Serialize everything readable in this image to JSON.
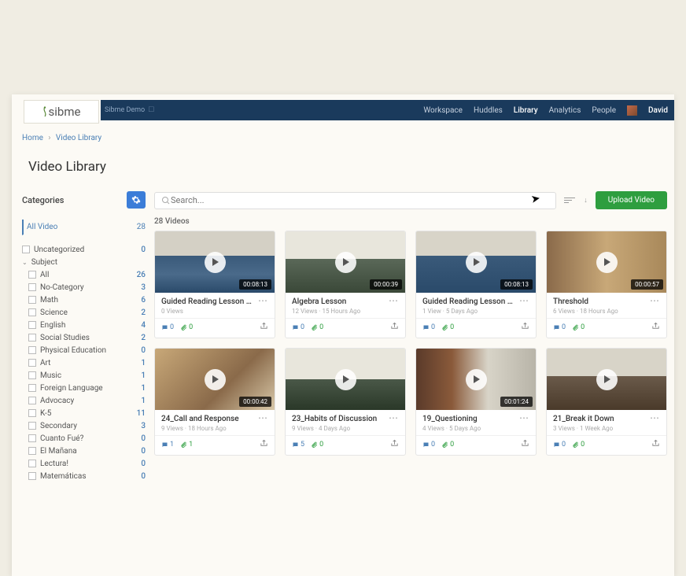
{
  "brand": "sibme",
  "subaccount": "Sibme Demo",
  "nav": {
    "items": [
      "Workspace",
      "Huddles",
      "Library",
      "Analytics",
      "People"
    ],
    "active": 2,
    "user": "David"
  },
  "breadcrumb": {
    "home": "Home",
    "page": "Video Library"
  },
  "page_title": "Video Library",
  "sidebar": {
    "title": "Categories",
    "all_video_label": "All Video",
    "all_video_count": "28",
    "uncategorized": {
      "label": "Uncategorized",
      "count": "0"
    },
    "subject_label": "Subject",
    "subjects": [
      {
        "label": "All",
        "count": "26"
      },
      {
        "label": "No-Category",
        "count": "3"
      },
      {
        "label": "Math",
        "count": "6"
      },
      {
        "label": "Science",
        "count": "2"
      },
      {
        "label": "English",
        "count": "4"
      },
      {
        "label": "Social Studies",
        "count": "2"
      },
      {
        "label": "Physical Education",
        "count": "0"
      },
      {
        "label": "Art",
        "count": "1"
      },
      {
        "label": "Music",
        "count": "1"
      },
      {
        "label": "Foreign Language",
        "count": "1"
      },
      {
        "label": "Advocacy",
        "count": "1"
      },
      {
        "label": "K-5",
        "count": "11"
      },
      {
        "label": "Secondary",
        "count": "3"
      },
      {
        "label": "Cuanto Fué?",
        "count": "0"
      },
      {
        "label": "El Mañana",
        "count": "0"
      },
      {
        "label": "Lectura!",
        "count": "0"
      },
      {
        "label": "Matemáticas",
        "count": "0"
      }
    ]
  },
  "search": {
    "placeholder": "Search..."
  },
  "upload_label": "Upload Video",
  "video_count": "28 Videos",
  "videos": [
    {
      "title": "Guided Reading Lesson 1...",
      "meta": "0 Views",
      "duration": "00:08:13",
      "c": "0",
      "a": "0",
      "thumb": "th1"
    },
    {
      "title": "Algebra Lesson",
      "meta": "12 Views · 15 Hours Ago",
      "duration": "00:00:39",
      "c": "0",
      "a": "0",
      "thumb": "th2"
    },
    {
      "title": "Guided Reading Lesson 1...",
      "meta": "1 View · 5 Days Ago",
      "duration": "00:08:13",
      "c": "0",
      "a": "0",
      "thumb": "th3"
    },
    {
      "title": "Threshold",
      "meta": "6 Views · 18 Hours Ago",
      "duration": "00:00:57",
      "c": "0",
      "a": "0",
      "thumb": "th4"
    },
    {
      "title": "24_Call and Response",
      "meta": "9 Views · 18 Hours Ago",
      "duration": "00:00:42",
      "c": "1",
      "a": "1",
      "thumb": "th5"
    },
    {
      "title": "23_Habits of Discussion",
      "meta": "9 Views · 4 Days Ago",
      "duration": "",
      "c": "5",
      "a": "0",
      "thumb": "th6"
    },
    {
      "title": "19_Questioning",
      "meta": "4 Views · 5 Days Ago",
      "duration": "00:01:24",
      "c": "0",
      "a": "0",
      "thumb": "th7"
    },
    {
      "title": "21_Break it Down",
      "meta": "3 Views · 1 Week Ago",
      "duration": "",
      "c": "0",
      "a": "0",
      "thumb": "th8"
    }
  ]
}
